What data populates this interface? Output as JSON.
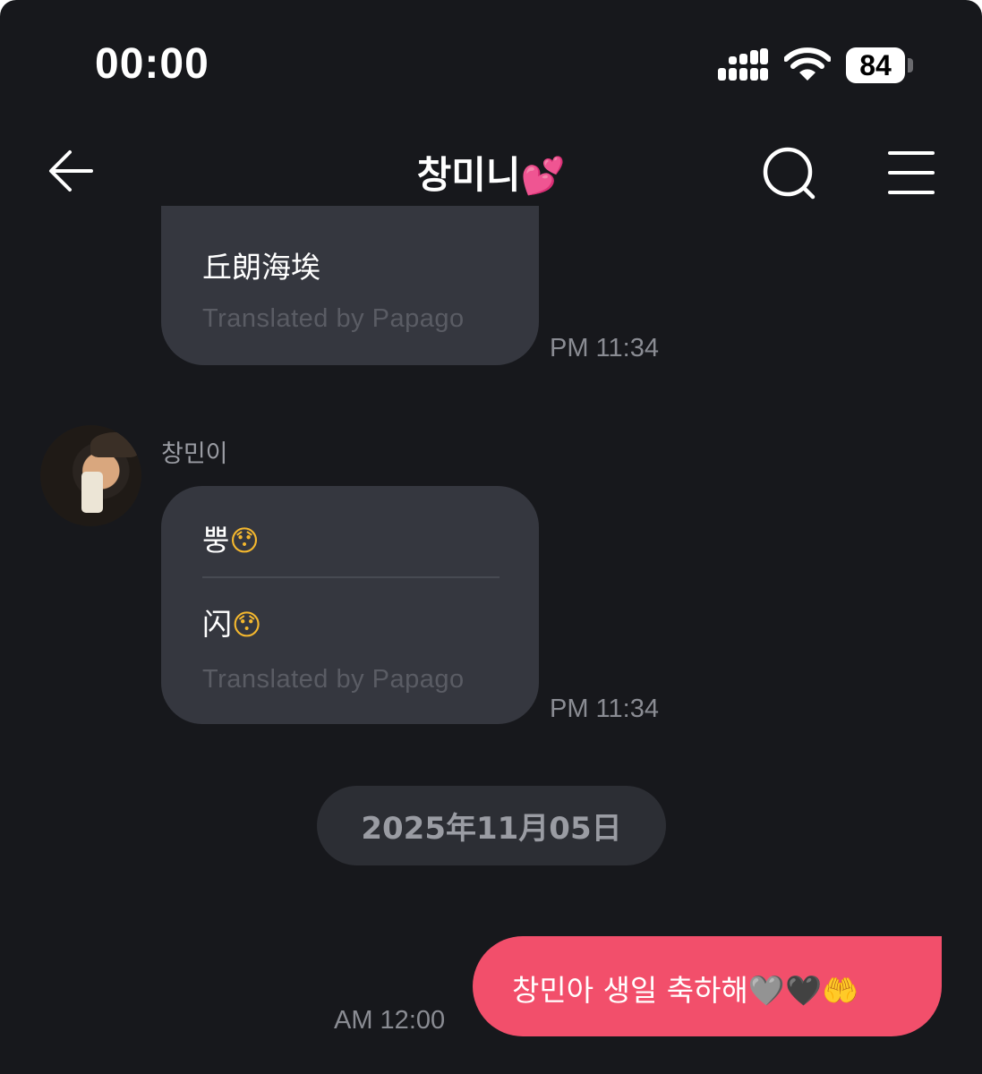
{
  "status_bar": {
    "time": "00:00",
    "battery": "84",
    "signal_icon": "signal-icon",
    "wifi_icon": "wifi-icon"
  },
  "header": {
    "title": "창미니",
    "title_emoji": "💕",
    "back_icon": "back-arrow-icon",
    "search_icon": "search-icon",
    "menu_icon": "menu-icon"
  },
  "messages": [
    {
      "text": "丘朗海埃",
      "translated_label": "Translated by Papago",
      "time": "PM 11:34"
    },
    {
      "sender": "창민이",
      "original_text": "뿡",
      "original_emoji": "😯",
      "translated_text": "闪",
      "translated_emoji": "😯",
      "translated_label": "Translated by Papago",
      "time": "PM 11:34"
    }
  ],
  "date_divider": "2025年11月05日",
  "my_message": {
    "text": "창민아 생일 축하해",
    "emoji_1": "🩶",
    "emoji_2": "🖤",
    "emoji_3": "🤲",
    "time": "AM 12:00"
  },
  "colors": {
    "background": "#17181c",
    "bubble": "#35373f",
    "my_bubble": "#f24f6b",
    "date_pill": "#2c2e34"
  }
}
